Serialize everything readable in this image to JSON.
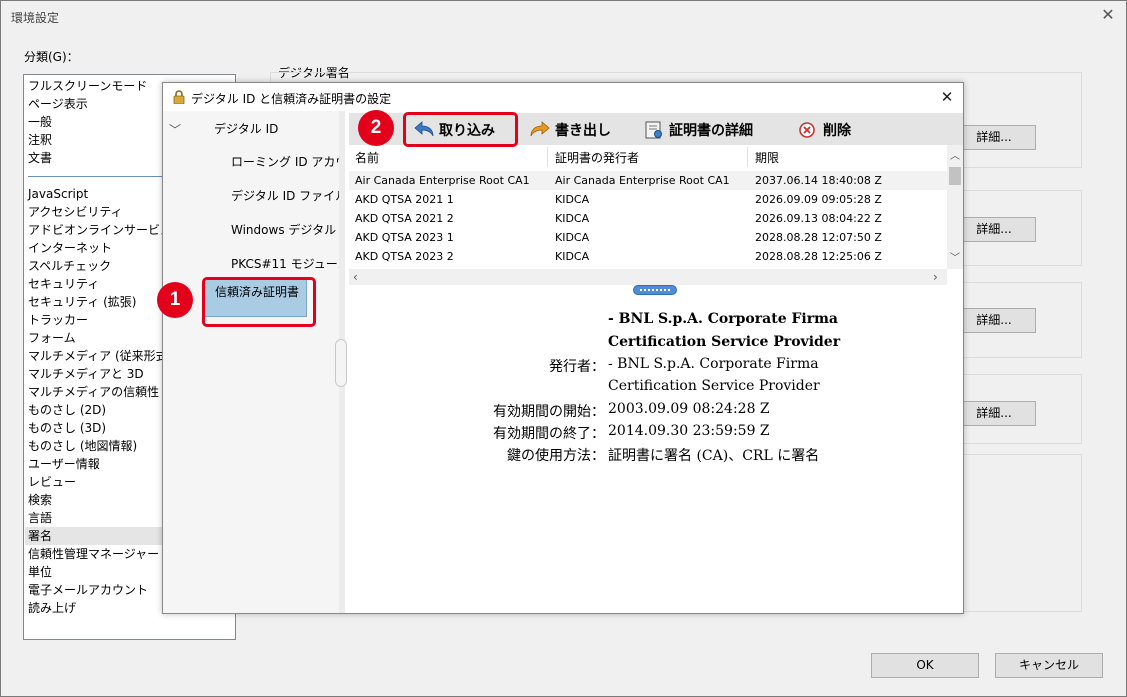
{
  "window": {
    "title": "環境設定"
  },
  "categories": {
    "label": "分類(G)：",
    "group1": [
      "フルスクリーンモード",
      "ページ表示",
      "一般",
      "注釈",
      "文書"
    ],
    "group2": [
      "JavaScript",
      "アクセシビリティ",
      "アドビオンラインサービス",
      "インターネット",
      "スペルチェック",
      "セキュリティ",
      "セキュリティ (拡張)",
      "トラッカー",
      "フォーム",
      "マルチメディア (従来形式)",
      "マルチメディアと 3D",
      "マルチメディアの信頼性 (従",
      "ものさし (2D)",
      "ものさし (3D)",
      "ものさし (地図情報)",
      "ユーザー情報",
      "レビュー",
      "検索",
      "言語",
      "署名",
      "信頼性管理マネージャー",
      "単位",
      "電子メールアカウント",
      "読み上げ"
    ],
    "selected": "署名"
  },
  "signature_panel": {
    "heading": "デジタル署名",
    "detail_button": "詳細..."
  },
  "footer": {
    "ok": "OK",
    "cancel": "キャンセル"
  },
  "dialog": {
    "title": "デジタル ID と信頼済み証明書の設定",
    "tree": {
      "root": "デジタル ID",
      "children": [
        "ローミング ID アカウン",
        "デジタル ID ファイル",
        "Windows デジタル II",
        "PKCS#11 モジュール"
      ],
      "trusted": "信頼済み証明書"
    },
    "toolbar": {
      "import": "取り込み",
      "export": "書き出し",
      "details": "証明書の詳細",
      "delete": "削除"
    },
    "table": {
      "columns": [
        "名前",
        "証明書の発行者",
        "期限"
      ],
      "rows": [
        [
          "Air Canada Enterprise Root CA1",
          "Air Canada Enterprise Root CA1",
          "2037.06.14 18:40:08 Z"
        ],
        [
          "AKD QTSA 2021 1",
          "KIDCA",
          "2026.09.09 09:05:28 Z"
        ],
        [
          "AKD QTSA 2021 2",
          "KIDCA",
          "2026.09.13 08:04:22 Z"
        ],
        [
          "AKD QTSA 2023 1",
          "KIDCA",
          "2028.08.28 12:07:50 Z"
        ],
        [
          "AKD QTSA 2023 2",
          "KIDCA",
          "2028.08.28 12:25:06 Z"
        ]
      ]
    },
    "detail": {
      "subject_line1": "- BNL S.p.A. Corporate Firma",
      "subject_line2": "Certification Service Provider",
      "issuer_key": "発行者：",
      "issuer_line1": "- BNL S.p.A. Corporate Firma",
      "issuer_line2": "Certification Service Provider",
      "valid_from_key": "有効期間の開始：",
      "valid_from": "2003.09.09 08:24:28 Z",
      "valid_to_key": "有効期間の終了：",
      "valid_to": "2014.09.30 23:59:59 Z",
      "key_usage_key": "鍵の使用方法：",
      "key_usage": "証明書に署名 (CA)、CRL に署名"
    }
  },
  "callouts": {
    "one": "1",
    "two": "2"
  },
  "colors": {
    "callout": "#e3001b",
    "selection": "#a9cbe4"
  }
}
